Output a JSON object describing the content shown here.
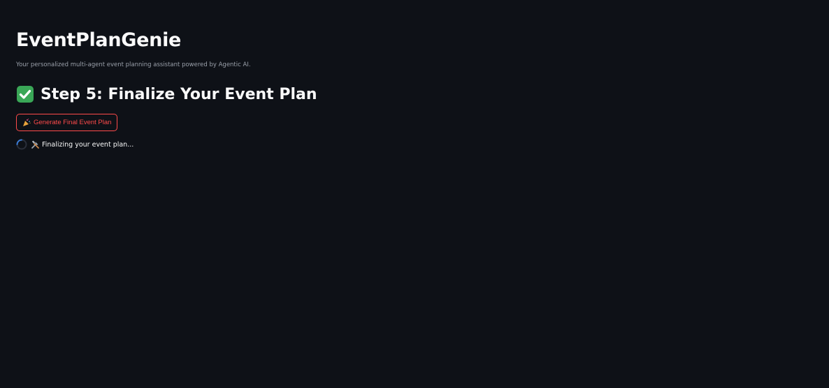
{
  "app": {
    "title": "EventPlanGenie",
    "subtitle": "Your personalized multi-agent event planning assistant powered by Agentic AI."
  },
  "step": {
    "icon": "check-mark-icon",
    "heading": "Step 5: Finalize Your Event Plan"
  },
  "actions": {
    "generate_icon": "party-popper-icon",
    "generate_label": "Generate Final Event Plan"
  },
  "status": {
    "spinner_icon": "spinner-icon",
    "tools_icon": "tools-icon",
    "text": "Finalizing your event plan..."
  },
  "colors": {
    "background": "#0e1117",
    "text": "#fafafa",
    "muted": "#9aa0aa",
    "accent": "#ff4b4b",
    "check_green": "#3aa757",
    "spinner": "#3a7bd5"
  }
}
